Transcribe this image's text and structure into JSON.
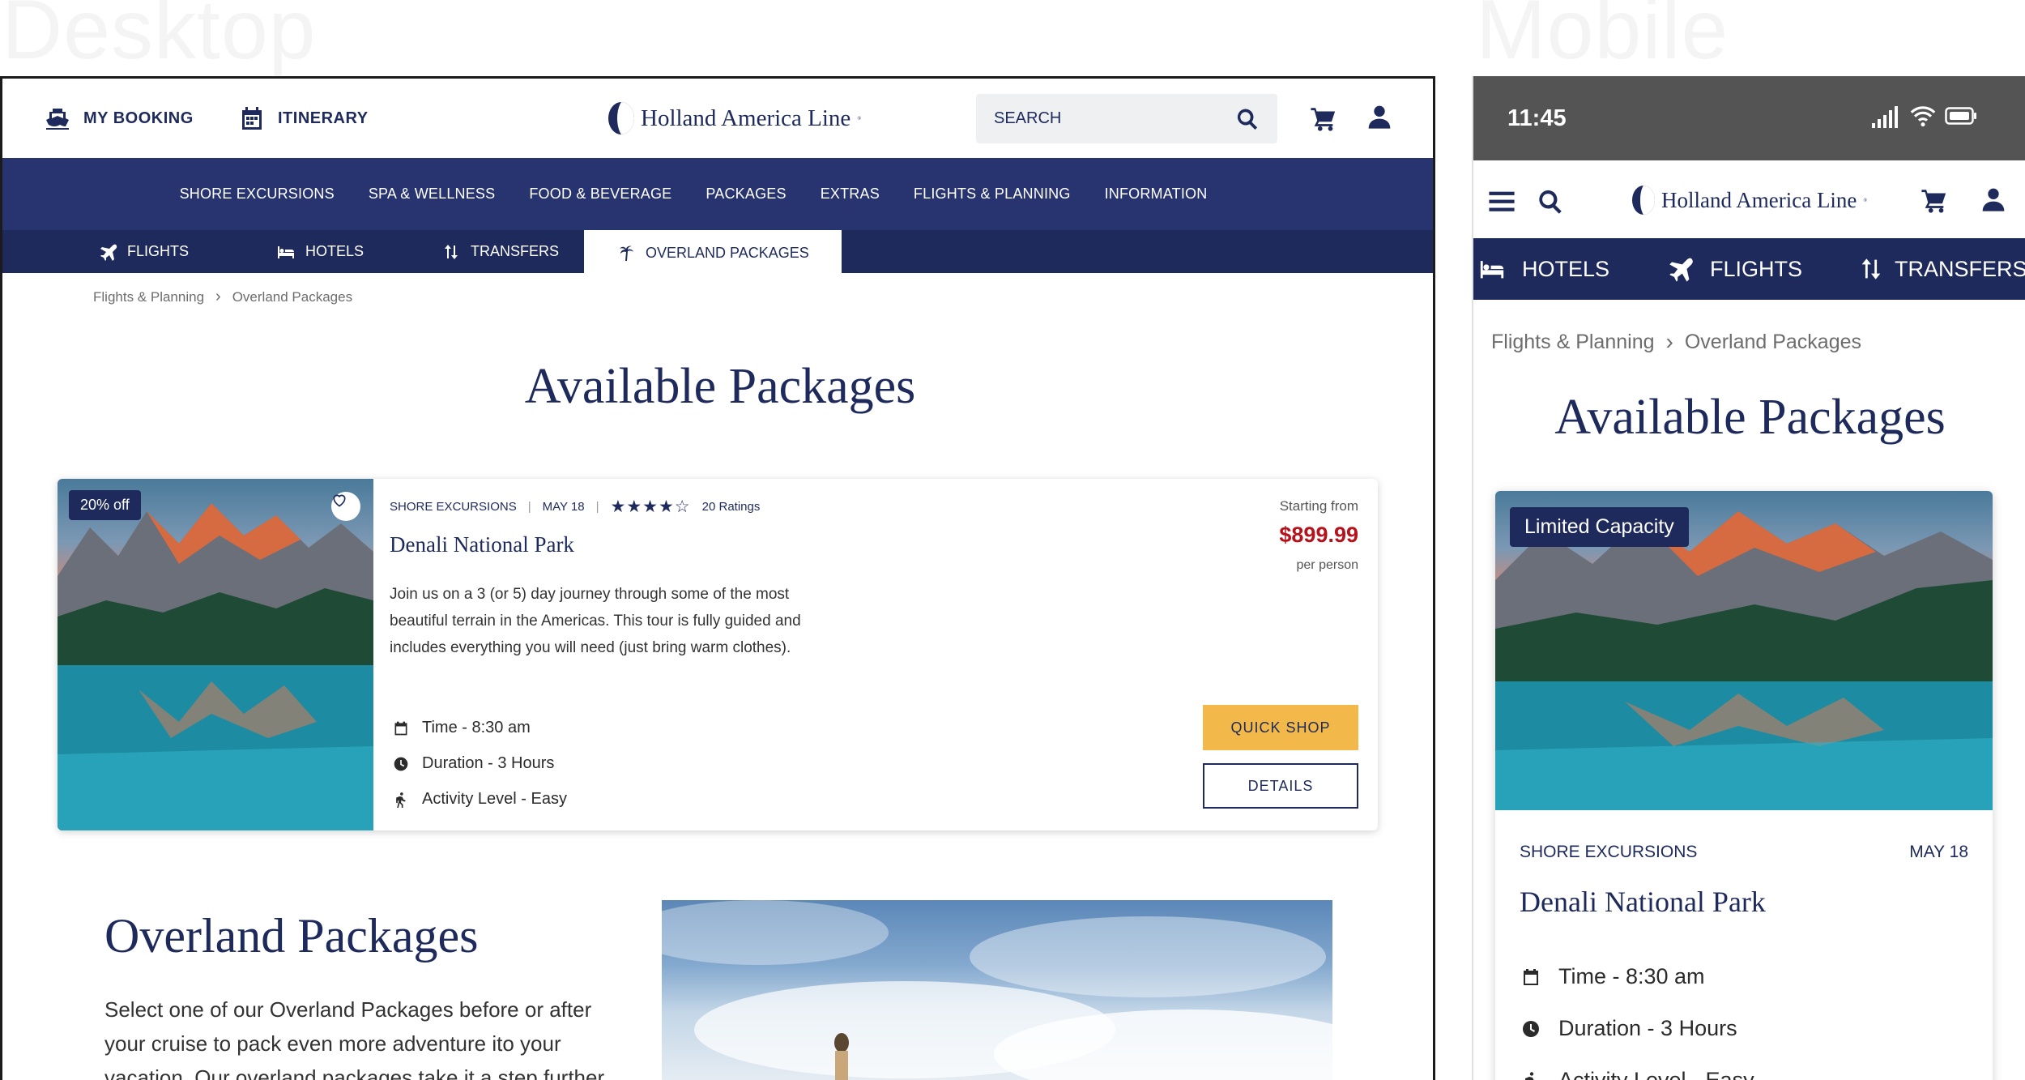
{
  "labels": {
    "desktop": "Desktop",
    "mobile": "Mobile"
  },
  "brand": {
    "name": "Holland America Line",
    "mark": "®",
    "primary_color": "#1d2a5b",
    "accent_color": "#f2b94a",
    "price_color": "#b5121b"
  },
  "desktop": {
    "top_links": {
      "my_booking": "MY BOOKING",
      "itinerary": "ITINERARY"
    },
    "search": {
      "placeholder": "SEARCH"
    },
    "main_nav": [
      "SHORE EXCURSIONS",
      "SPA & WELLNESS",
      "FOOD & BEVERAGE",
      "PACKAGES",
      "EXTRAS",
      "FLIGHTS & PLANNING",
      "INFORMATION"
    ],
    "sub_nav": {
      "flights": "FLIGHTS",
      "hotels": "HOTELS",
      "transfers": "TRANSFERS",
      "overland": "OVERLAND PACKAGES"
    },
    "breadcrumb": {
      "parent": "Flights & Planning",
      "separator": "›",
      "current": "Overland Packages"
    },
    "page_title": "Available Packages",
    "card": {
      "badge": "20% off",
      "category": "SHORE EXCURSIONS",
      "date": "MAY 18",
      "stars": "★★★★☆",
      "rating_count": "20 Ratings",
      "rating_value": 4,
      "rating_max": 5,
      "title": "Denali National Park",
      "description": "Join us on a 3 (or 5) day journey through some of the most beautiful terrain in the Americas. This tour is fully guided and includes everything you will need (just bring warm clothes).",
      "time": "Time - 8:30 am",
      "duration": "Duration - 3 Hours",
      "activity": "Activity Level - Easy",
      "price_label": "Starting from",
      "price": "$899.99",
      "price_unit": "per person",
      "quick_shop": "QUICK SHOP",
      "details": "DETAILS"
    },
    "overland": {
      "title": "Overland Packages",
      "text": "Select one of our Overland Packages before or after your cruise to pack even more adventure ito your vacation. Our overland packages take it a step further."
    }
  },
  "mobile": {
    "time": "11:45",
    "tabs": {
      "hotels": "HOTELS",
      "flights": "FLIGHTS",
      "transfers": "TRANSFERS"
    },
    "breadcrumb": {
      "parent": "Flights & Planning",
      "separator": "›",
      "current": "Overland Packages"
    },
    "page_title": "Available Packages",
    "card": {
      "badge": "Limited Capacity",
      "category": "SHORE EXCURSIONS",
      "date": "MAY 18",
      "title": "Denali National Park",
      "time": "Time - 8:30 am",
      "duration": "Duration - 3 Hours",
      "activity": "Activity Level - Easy"
    }
  }
}
